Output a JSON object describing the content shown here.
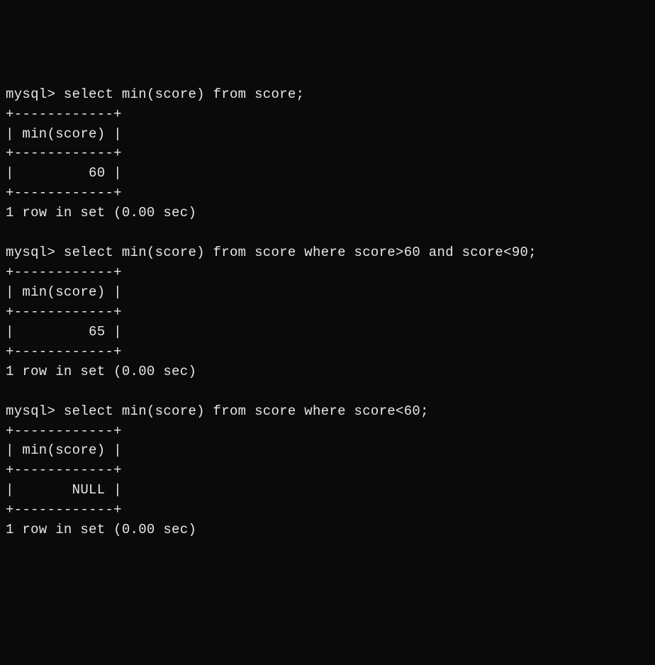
{
  "queries": [
    {
      "prompt": "mysql> ",
      "statement": "select min(score) from score;",
      "border": "+------------+",
      "header": "| min(score) |",
      "value": "|         60 |",
      "footer": "1 row in set (0.00 sec)"
    },
    {
      "prompt": "mysql> ",
      "statement": "select min(score) from score where score>60 and score<90;",
      "border": "+------------+",
      "header": "| min(score) |",
      "value": "|         65 |",
      "footer": "1 row in set (0.00 sec)"
    },
    {
      "prompt": "mysql> ",
      "statement": "select min(score) from score where score<60;",
      "border": "+------------+",
      "header": "| min(score) |",
      "value": "|       NULL |",
      "footer": "1 row in set (0.00 sec)"
    }
  ]
}
